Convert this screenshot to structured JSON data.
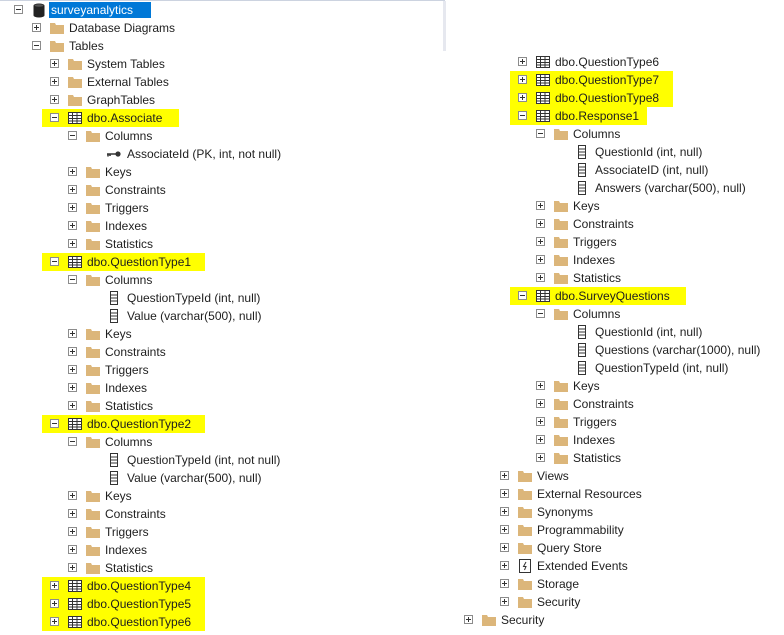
{
  "colors": {
    "highlight": "#ffff00",
    "selection": "#0078d7",
    "folder": "#dcb67a"
  },
  "left_tree": [
    {
      "label": "surveyanalytics",
      "level": 1,
      "toggle": "minus",
      "icon": "database",
      "selected": true
    },
    {
      "label": "Database Diagrams",
      "level": 2,
      "toggle": "plus",
      "icon": "folder"
    },
    {
      "label": "Tables",
      "level": 2,
      "toggle": "minus",
      "icon": "folder"
    },
    {
      "label": "System Tables",
      "level": 3,
      "toggle": "plus",
      "icon": "folder"
    },
    {
      "label": "External Tables",
      "level": 3,
      "toggle": "plus",
      "icon": "folder"
    },
    {
      "label": "GraphTables",
      "level": 3,
      "toggle": "plus",
      "icon": "folder"
    },
    {
      "label": "dbo.Associate",
      "level": 3,
      "toggle": "minus",
      "icon": "table",
      "highlighted": true
    },
    {
      "label": "Columns",
      "level": 4,
      "toggle": "minus",
      "icon": "folder"
    },
    {
      "label": "AssociateId (PK, int, not null)",
      "level": 5,
      "toggle": "none",
      "icon": "key"
    },
    {
      "label": "Keys",
      "level": 4,
      "toggle": "plus",
      "icon": "folder"
    },
    {
      "label": "Constraints",
      "level": 4,
      "toggle": "plus",
      "icon": "folder"
    },
    {
      "label": "Triggers",
      "level": 4,
      "toggle": "plus",
      "icon": "folder"
    },
    {
      "label": "Indexes",
      "level": 4,
      "toggle": "plus",
      "icon": "folder"
    },
    {
      "label": "Statistics",
      "level": 4,
      "toggle": "plus",
      "icon": "folder"
    },
    {
      "label": "dbo.QuestionType1",
      "level": 3,
      "toggle": "minus",
      "icon": "table",
      "highlighted": true
    },
    {
      "label": "Columns",
      "level": 4,
      "toggle": "minus",
      "icon": "folder"
    },
    {
      "label": "QuestionTypeId (int, null)",
      "level": 5,
      "toggle": "none",
      "icon": "column"
    },
    {
      "label": "Value (varchar(500), null)",
      "level": 5,
      "toggle": "none",
      "icon": "column"
    },
    {
      "label": "Keys",
      "level": 4,
      "toggle": "plus",
      "icon": "folder"
    },
    {
      "label": "Constraints",
      "level": 4,
      "toggle": "plus",
      "icon": "folder"
    },
    {
      "label": "Triggers",
      "level": 4,
      "toggle": "plus",
      "icon": "folder"
    },
    {
      "label": "Indexes",
      "level": 4,
      "toggle": "plus",
      "icon": "folder"
    },
    {
      "label": "Statistics",
      "level": 4,
      "toggle": "plus",
      "icon": "folder"
    },
    {
      "label": "dbo.QuestionType2",
      "level": 3,
      "toggle": "minus",
      "icon": "table",
      "highlighted": true
    },
    {
      "label": "Columns",
      "level": 4,
      "toggle": "minus",
      "icon": "folder"
    },
    {
      "label": "QuestionTypeId (int, not null)",
      "level": 5,
      "toggle": "none",
      "icon": "column"
    },
    {
      "label": "Value (varchar(500), null)",
      "level": 5,
      "toggle": "none",
      "icon": "column"
    },
    {
      "label": "Keys",
      "level": 4,
      "toggle": "plus",
      "icon": "folder"
    },
    {
      "label": "Constraints",
      "level": 4,
      "toggle": "plus",
      "icon": "folder"
    },
    {
      "label": "Triggers",
      "level": 4,
      "toggle": "plus",
      "icon": "folder"
    },
    {
      "label": "Indexes",
      "level": 4,
      "toggle": "plus",
      "icon": "folder"
    },
    {
      "label": "Statistics",
      "level": 4,
      "toggle": "plus",
      "icon": "folder"
    },
    {
      "label": "dbo.QuestionType4",
      "level": 3,
      "toggle": "plus",
      "icon": "table",
      "highlighted": true
    },
    {
      "label": "dbo.QuestionType5",
      "level": 3,
      "toggle": "plus",
      "icon": "table",
      "highlighted": true
    },
    {
      "label": "dbo.QuestionType6",
      "level": 3,
      "toggle": "plus",
      "icon": "table",
      "highlighted": true
    }
  ],
  "right_tree": [
    {
      "label": "dbo.QuestionType6",
      "level": 3,
      "toggle": "plus",
      "icon": "table"
    },
    {
      "label": "dbo.QuestionType7",
      "level": 3,
      "toggle": "plus",
      "icon": "table",
      "highlighted": true
    },
    {
      "label": "dbo.QuestionType8",
      "level": 3,
      "toggle": "plus",
      "icon": "table",
      "highlighted": true
    },
    {
      "label": "dbo.Response1",
      "level": 3,
      "toggle": "minus",
      "icon": "table",
      "highlighted": true
    },
    {
      "label": "Columns",
      "level": 4,
      "toggle": "minus",
      "icon": "folder"
    },
    {
      "label": "QuestionId (int, null)",
      "level": 5,
      "toggle": "none",
      "icon": "column"
    },
    {
      "label": "AssociateID (int, null)",
      "level": 5,
      "toggle": "none",
      "icon": "column"
    },
    {
      "label": "Answers (varchar(500), null)",
      "level": 5,
      "toggle": "none",
      "icon": "column"
    },
    {
      "label": "Keys",
      "level": 4,
      "toggle": "plus",
      "icon": "folder"
    },
    {
      "label": "Constraints",
      "level": 4,
      "toggle": "plus",
      "icon": "folder"
    },
    {
      "label": "Triggers",
      "level": 4,
      "toggle": "plus",
      "icon": "folder"
    },
    {
      "label": "Indexes",
      "level": 4,
      "toggle": "plus",
      "icon": "folder"
    },
    {
      "label": "Statistics",
      "level": 4,
      "toggle": "plus",
      "icon": "folder"
    },
    {
      "label": "dbo.SurveyQuestions",
      "level": 3,
      "toggle": "minus",
      "icon": "table",
      "highlighted": true
    },
    {
      "label": "Columns",
      "level": 4,
      "toggle": "minus",
      "icon": "folder"
    },
    {
      "label": "QuestionId (int, null)",
      "level": 5,
      "toggle": "none",
      "icon": "column"
    },
    {
      "label": "Questions (varchar(1000), null)",
      "level": 5,
      "toggle": "none",
      "icon": "column"
    },
    {
      "label": "QuestionTypeId (int, null)",
      "level": 5,
      "toggle": "none",
      "icon": "column"
    },
    {
      "label": "Keys",
      "level": 4,
      "toggle": "plus",
      "icon": "folder"
    },
    {
      "label": "Constraints",
      "level": 4,
      "toggle": "plus",
      "icon": "folder"
    },
    {
      "label": "Triggers",
      "level": 4,
      "toggle": "plus",
      "icon": "folder"
    },
    {
      "label": "Indexes",
      "level": 4,
      "toggle": "plus",
      "icon": "folder"
    },
    {
      "label": "Statistics",
      "level": 4,
      "toggle": "plus",
      "icon": "folder"
    },
    {
      "label": "Views",
      "level": 2,
      "toggle": "plus",
      "icon": "folder"
    },
    {
      "label": "External Resources",
      "level": 2,
      "toggle": "plus",
      "icon": "folder"
    },
    {
      "label": "Synonyms",
      "level": 2,
      "toggle": "plus",
      "icon": "folder"
    },
    {
      "label": "Programmability",
      "level": 2,
      "toggle": "plus",
      "icon": "folder"
    },
    {
      "label": "Query Store",
      "level": 2,
      "toggle": "plus",
      "icon": "folder"
    },
    {
      "label": "Extended Events",
      "level": 2,
      "toggle": "plus",
      "icon": "extended-events"
    },
    {
      "label": "Storage",
      "level": 2,
      "toggle": "plus",
      "icon": "folder"
    },
    {
      "label": "Security",
      "level": 2,
      "toggle": "plus",
      "icon": "folder"
    },
    {
      "label": "Security",
      "level": 0,
      "toggle": "plus",
      "icon": "folder"
    }
  ]
}
